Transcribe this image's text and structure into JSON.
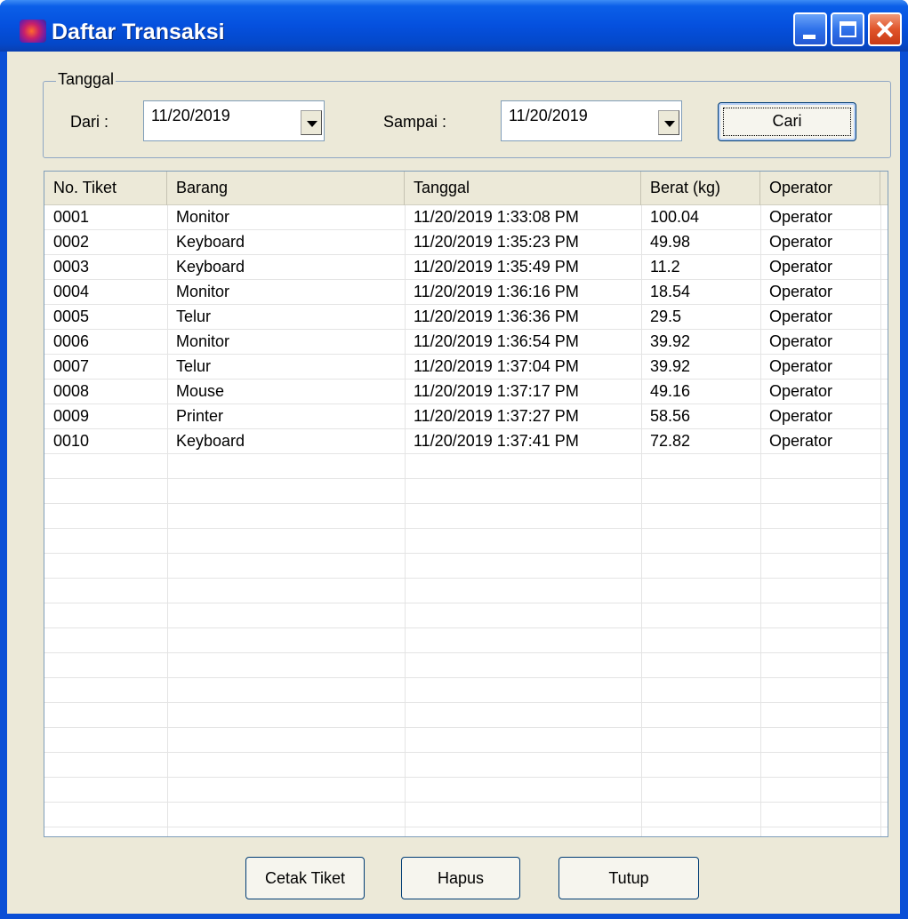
{
  "window": {
    "title": "Daftar Transaksi"
  },
  "filter": {
    "group_label": "Tanggal",
    "from_label": "Dari :",
    "from_value": "11/20/2019",
    "to_label": "Sampai :",
    "to_value": "11/20/2019",
    "search_button": "Cari"
  },
  "table": {
    "columns": [
      "No. Tiket",
      "Barang",
      "Tanggal",
      "Berat (kg)",
      "Operator"
    ],
    "rows": [
      [
        "0001",
        "Monitor",
        "11/20/2019 1:33:08 PM",
        "100.04",
        "Operator"
      ],
      [
        "0002",
        "Keyboard",
        "11/20/2019 1:35:23 PM",
        "49.98",
        "Operator"
      ],
      [
        "0003",
        "Keyboard",
        "11/20/2019 1:35:49 PM",
        "11.2",
        "Operator"
      ],
      [
        "0004",
        "Monitor",
        "11/20/2019 1:36:16 PM",
        "18.54",
        "Operator"
      ],
      [
        "0005",
        "Telur",
        "11/20/2019 1:36:36 PM",
        "29.5",
        "Operator"
      ],
      [
        "0006",
        "Monitor",
        "11/20/2019 1:36:54 PM",
        "39.92",
        "Operator"
      ],
      [
        "0007",
        "Telur",
        "11/20/2019 1:37:04 PM",
        "39.92",
        "Operator"
      ],
      [
        "0008",
        "Mouse",
        "11/20/2019 1:37:17 PM",
        "49.16",
        "Operator"
      ],
      [
        "0009",
        "Printer",
        "11/20/2019 1:37:27 PM",
        "58.56",
        "Operator"
      ],
      [
        "0010",
        "Keyboard",
        "11/20/2019 1:37:41 PM",
        "72.82",
        "Operator"
      ]
    ]
  },
  "footer": {
    "print_button": "Cetak Tiket",
    "delete_button": "Hapus",
    "close_button": "Tutup"
  },
  "colors": {
    "titlebar": "#0550de",
    "client_bg": "#ece9d8",
    "close_button": "#e0542a"
  },
  "icons": {
    "app": "app-icon",
    "minimize": "minimize-icon",
    "maximize": "maximize-icon",
    "close": "close-icon",
    "dropdown": "chevron-down-icon"
  }
}
